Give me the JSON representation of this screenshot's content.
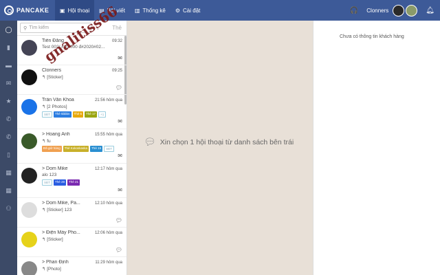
{
  "header": {
    "logo_text": "PANCAKE",
    "nav": [
      {
        "label": "Hội thoại",
        "icon": "chat-icon",
        "glyph": "▣",
        "active": true
      },
      {
        "label": "Bài viết",
        "icon": "post-icon",
        "glyph": "▤",
        "active": false
      },
      {
        "label": "Thống kê",
        "icon": "stats-icon",
        "glyph": "▥",
        "active": false
      },
      {
        "label": "Cài đặt",
        "icon": "gear-icon",
        "glyph": "⚙",
        "active": false
      }
    ],
    "user_name": "Clonners"
  },
  "search": {
    "placeholder": "Tìm kiếm",
    "tag_filter": "Thẻ"
  },
  "conversations": [
    {
      "name": "Tiến Đăng",
      "time": "09:32",
      "msg": "Test 002/ #30.000 đ#2020#02...",
      "avatar_color": "#445",
      "tags": [],
      "icon": "envelope"
    },
    {
      "name": "Clonners",
      "time": "09:25",
      "msg": "↰ [Sticker]",
      "avatar_color": "#111",
      "tags": [],
      "icon": "comment"
    },
    {
      "name": "Trần Văn Khoa",
      "time": "21:56 hôm qua",
      "msg": "↰ [2 Photos]",
      "avatar_color": "#1a73e8",
      "tags": [
        {
          "label": "SĐT",
          "color": "outline"
        },
        {
          "label": "Thẻ 5bbbn",
          "color": "#2a7de1"
        },
        {
          "label": "Thẻ 6",
          "color": "#e8a90c"
        },
        {
          "label": "Thẻ 17",
          "color": "#9aa612"
        },
        {
          "label": "+1",
          "color": "outline"
        }
      ],
      "icon": "envelope"
    },
    {
      "name": "> Hoang Anh",
      "time": "15:55 hôm qua",
      "msg": "↰ fu",
      "avatar_color": "#3a5a2a",
      "tags": [
        {
          "label": "Đã giữ hàng",
          "color": "#f0a050"
        },
        {
          "label": "Thẻ Kokoskaska",
          "color": "#c8b02a"
        },
        {
          "label": "Thẻ 15",
          "color": "#2a8fd1"
        },
        {
          "label": "SĐT",
          "color": "outline"
        }
      ],
      "icon": "envelope"
    },
    {
      "name": "> Dom Mike",
      "time": "12:17 hôm qua",
      "msg": "alo 123",
      "avatar_color": "#222",
      "tags": [
        {
          "label": "SĐT",
          "color": "outline"
        },
        {
          "label": "Thẻ 28",
          "color": "#2a5de1"
        },
        {
          "label": "Thẻ 21",
          "color": "#7a2ab0"
        }
      ],
      "icon": "envelope"
    },
    {
      "name": "> Dom Mike, Pa...",
      "time": "12:10 hôm qua",
      "msg": "↰ [Sticker] 123",
      "avatar_color": "#ddd",
      "tags": [],
      "icon": "comment"
    },
    {
      "name": "> Điện Máy Pho...",
      "time": "12:06 hôm qua",
      "msg": "↰ [Sticker]",
      "avatar_color": "#e6d21a",
      "tags": [],
      "icon": "comment"
    },
    {
      "name": "> Phan Định",
      "time": "11:29 hôm qua",
      "msg": "↰ [Photo]",
      "avatar_color": "#888",
      "tags": [],
      "icon": "comment"
    }
  ],
  "main": {
    "empty_text": "Xin chọn 1 hội thoại từ danh sách bên trái"
  },
  "customer_panel": {
    "no_info_text": "Chưa có thông tin khách hàng"
  },
  "watermark": "gnalitiss66",
  "rail_icons": [
    "circle-icon",
    "bookmark-icon",
    "message-icon",
    "mail-icon",
    "star-icon",
    "phone-icon",
    "phone-off-icon",
    "document-icon",
    "calendar-icon",
    "calendar-grid-icon",
    "group-icon"
  ]
}
